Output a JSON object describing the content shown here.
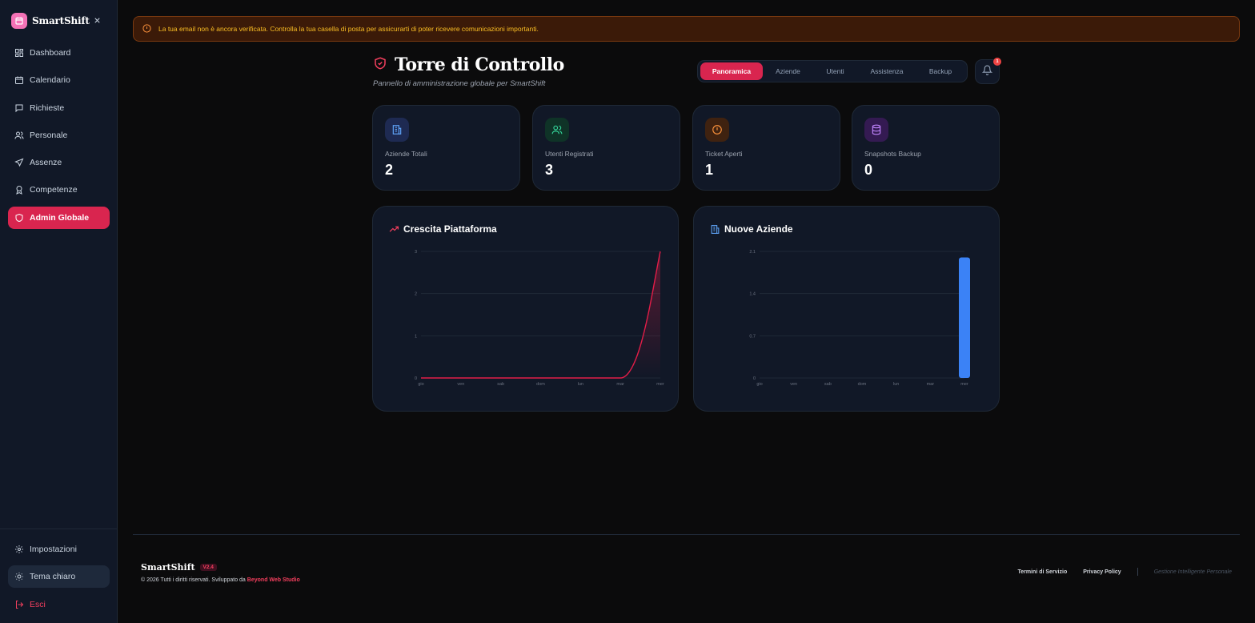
{
  "sidebar": {
    "brand": "SmartShift",
    "items": [
      {
        "label": "Dashboard",
        "icon": "grid-icon"
      },
      {
        "label": "Calendario",
        "icon": "calendar-icon"
      },
      {
        "label": "Richieste",
        "icon": "message-icon"
      },
      {
        "label": "Personale",
        "icon": "users-icon"
      },
      {
        "label": "Assenze",
        "icon": "plane-icon"
      },
      {
        "label": "Competenze",
        "icon": "award-icon"
      },
      {
        "label": "Admin Globale",
        "icon": "shield-icon",
        "active": true
      }
    ],
    "bottom": [
      {
        "label": "Impostazioni",
        "icon": "gear-icon"
      },
      {
        "label": "Tema chiaro",
        "icon": "sun-icon"
      },
      {
        "label": "Esci",
        "icon": "logout-icon"
      }
    ]
  },
  "alert": {
    "text": "La tua email non è ancora verificata. Controlla la tua casella di posta per assicurarti di poter ricevere comunicazioni importanti."
  },
  "header": {
    "title": "Torre di Controllo",
    "subtitle": "Pannello di amministrazione globale per SmartShift",
    "tabs": [
      "Panoramica",
      "Aziende",
      "Utenti",
      "Assistenza",
      "Backup"
    ],
    "active_tab": "Panoramica",
    "notifications": "1"
  },
  "stats": [
    {
      "label": "Aziende Totali",
      "value": "2",
      "color": "#60a5fa",
      "bg": "#1e2a52"
    },
    {
      "label": "Utenti Registrati",
      "value": "3",
      "color": "#34d399",
      "bg": "#0f3327"
    },
    {
      "label": "Ticket Aperti",
      "value": "1",
      "color": "#fb923c",
      "bg": "#3f2210"
    },
    {
      "label": "Snapshots Backup",
      "value": "0",
      "color": "#c084fc",
      "bg": "#341a52"
    }
  ],
  "chart_data": [
    {
      "type": "area",
      "title": "Crescita Piattaforma",
      "categories": [
        "gio",
        "ven",
        "sab",
        "dom",
        "lun",
        "mar",
        "mer"
      ],
      "series": [
        {
          "values": [
            0,
            0,
            0,
            0,
            0,
            0,
            3
          ]
        }
      ],
      "yticks": [
        "0",
        "1",
        "2",
        "3"
      ],
      "ylim": [
        0,
        3
      ],
      "color": "#e11d48"
    },
    {
      "type": "bar",
      "title": "Nuove Aziende",
      "categories": [
        "gio",
        "ven",
        "sab",
        "dom",
        "lun",
        "mar",
        "mer"
      ],
      "series": [
        {
          "values": [
            0,
            0,
            0,
            0,
            0,
            0,
            2
          ]
        }
      ],
      "yticks": [
        "0",
        "0.7",
        "1.4",
        "2.1"
      ],
      "ylim": [
        0,
        2.1
      ],
      "color": "#3b82f6"
    }
  ],
  "footer": {
    "brand": "SmartShift",
    "version": "V2.4",
    "copyright": "© 2026 Tutti i diritti riservati. Sviluppato da",
    "studio": "Beyond Web Studio",
    "links": [
      "Termini di Servizio",
      "Privacy Policy"
    ],
    "tagline": "Gestione Intelligente Personale"
  }
}
